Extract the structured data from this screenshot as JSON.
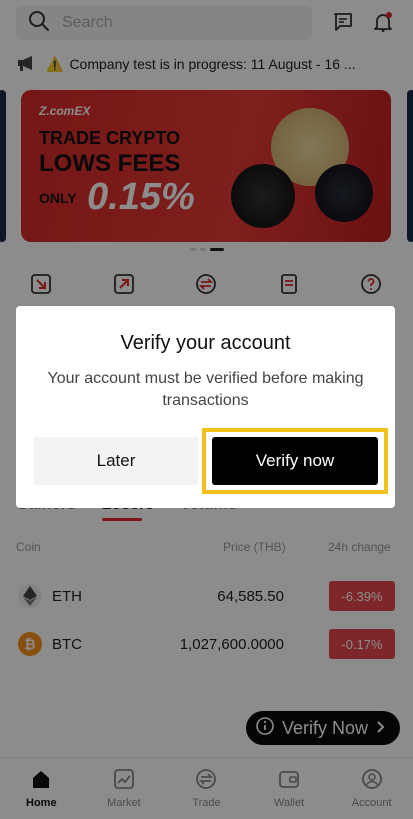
{
  "header": {
    "search_placeholder": "Search",
    "icons": [
      "search-icon",
      "chat-icon",
      "bell-icon"
    ]
  },
  "announcement": {
    "text": "Company test is in progress: 11 August - 16 ...",
    "icons": [
      "megaphone-icon",
      "warning-icon"
    ]
  },
  "banner": {
    "brand": "Z.comEX",
    "line1": "TRADE CRYPTO",
    "line2": "LOWS FEES",
    "line3": "ONLY",
    "percent": "0.15%"
  },
  "quick_actions": [
    "deposit-icon",
    "withdraw-icon",
    "convert-icon",
    "document-icon",
    "help-icon"
  ],
  "market_tabs": [
    "Gainers",
    "Losers",
    "Volume"
  ],
  "columns": {
    "coin": "Coin",
    "price": "Price (THB)",
    "change": "24h change"
  },
  "rows": [
    {
      "symbol": "ETH",
      "price": "64,585.50",
      "change": "-6.39%"
    },
    {
      "symbol": "BTC",
      "price": "1,027,600.0000",
      "change": "-0.17%"
    }
  ],
  "float_button": {
    "label": "Verify Now"
  },
  "bottom_nav": [
    {
      "label": "Home",
      "icon": "home-icon",
      "active": true
    },
    {
      "label": "Market",
      "icon": "chart-icon",
      "active": false
    },
    {
      "label": "Trade",
      "icon": "trade-icon",
      "active": false
    },
    {
      "label": "Wallet",
      "icon": "wallet-icon",
      "active": false
    },
    {
      "label": "Account",
      "icon": "account-icon",
      "active": false
    }
  ],
  "modal": {
    "title": "Verify your account",
    "message": "Your account must be verified before making transactions",
    "later_label": "Later",
    "verify_label": "Verify now"
  },
  "colors": {
    "accent_red": "#e02b2b",
    "change_red": "#e5484d",
    "highlight_yellow": "#f2c11a"
  }
}
